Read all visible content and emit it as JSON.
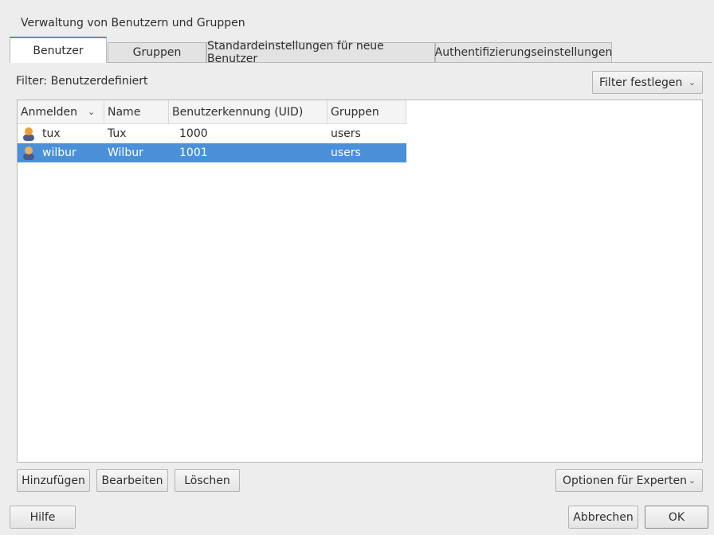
{
  "window": {
    "title": "Verwaltung von Benutzern und Gruppen"
  },
  "tabs": [
    {
      "label": "Benutzer",
      "active": true
    },
    {
      "label": "Gruppen"
    },
    {
      "label": "Standardeinstellungen für neue Benutzer"
    },
    {
      "label": "Authentifizierungseinstellungen"
    }
  ],
  "filter": {
    "label": "Filter: Benutzerdefiniert",
    "button_label": "Filter festlegen"
  },
  "table": {
    "headers": [
      "Anmelden",
      "Name",
      "Benutzerkennung (UID)",
      "Gruppen"
    ],
    "rows": [
      {
        "login": "tux",
        "name": "Tux",
        "uid": "1000",
        "groups": "users",
        "selected": false
      },
      {
        "login": "wilbur",
        "name": "Wilbur",
        "uid": "1001",
        "groups": "users",
        "selected": true
      }
    ]
  },
  "actions": {
    "add": "Hinzufügen",
    "edit": "Bearbeiten",
    "delete": "Löschen",
    "expert": "Optionen für Experten"
  },
  "footer": {
    "help": "Hilfe",
    "cancel": "Abbrechen",
    "ok": "OK"
  },
  "colors": {
    "accent": "#4a90d9",
    "icon_orange": "#f0a030"
  }
}
